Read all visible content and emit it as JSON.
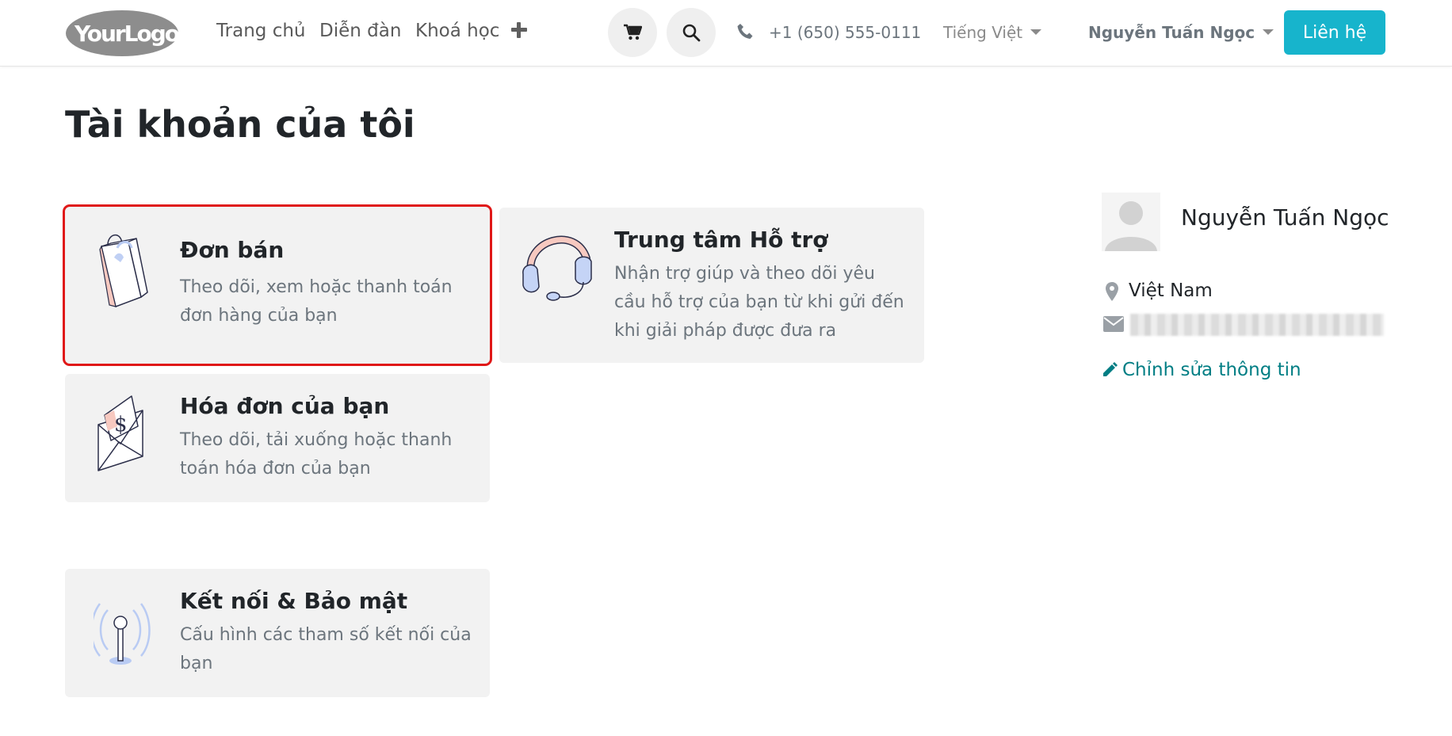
{
  "header": {
    "logo_text": "YourLogo",
    "nav": [
      "Trang chủ",
      "Diễn đàn",
      "Khoá học"
    ],
    "phone": "+1 (650) 555-0111",
    "language": "Tiếng Việt",
    "user": "Nguyễn Tuấn Ngọc",
    "contact_label": "Liên hệ",
    "icons": [
      "plus-icon",
      "cart-icon",
      "search-icon",
      "phone-icon",
      "caret-down-icon"
    ]
  },
  "main": {
    "title": "Tài khoản của tôi",
    "cards": [
      {
        "title": "Đơn bán",
        "desc": "Theo dõi, xem hoặc thanh toán đơn hàng của bạn",
        "icon": "shopping-bag-icon",
        "selected": true
      },
      {
        "title": "Trung tâm Hỗ trợ",
        "desc": "Nhận trợ giúp và theo dõi yêu cầu hỗ trợ của bạn từ khi gửi đến khi giải pháp được đưa ra",
        "icon": "headset-icon"
      },
      {
        "title": "Hóa đơn của bạn",
        "desc": "Theo dõi, tải xuống hoặc thanh toán hóa đơn của bạn",
        "icon": "invoice-envelope-icon"
      },
      {
        "title": "Kết nối & Bảo mật",
        "desc": "Cấu hình các tham số kết nối của bạn",
        "icon": "antenna-icon"
      }
    ]
  },
  "sidebar": {
    "name": "Nguyễn Tuấn Ngọc",
    "country": "Việt Nam",
    "edit_label": "Chỉnh sửa thông tin",
    "icons": [
      "avatar-icon",
      "map-marker-icon",
      "envelope-icon",
      "pencil-icon"
    ]
  },
  "colors": {
    "accent": "#17b4cc",
    "link": "#017e84",
    "card_bg": "#f2f2f2",
    "selection": "#e01818"
  }
}
